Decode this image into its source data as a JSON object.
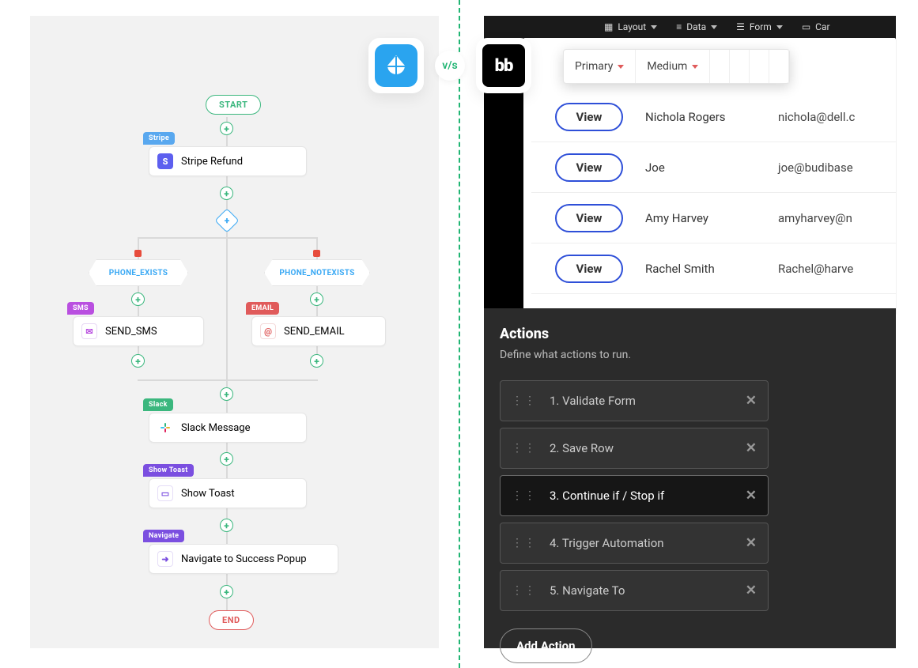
{
  "compare": {
    "vs_label": "v/s",
    "right_logo_text": "bb"
  },
  "flow": {
    "start_label": "START",
    "end_label": "END",
    "nodes": {
      "stripe": {
        "tag": "Stripe",
        "tag_color": "#59a8ef",
        "label": "Stripe Refund"
      },
      "sms": {
        "tag": "SMS",
        "tag_color": "#b94fe0",
        "label": "SEND_SMS"
      },
      "email": {
        "tag": "EMAIL",
        "tag_color": "#e05b5b",
        "label": "SEND_EMAIL"
      },
      "slack": {
        "tag": "Slack",
        "tag_color": "#3bb77e",
        "label": "Slack Message"
      },
      "toast": {
        "tag": "Show Toast",
        "tag_color": "#7b4fe0",
        "label": "Show Toast"
      },
      "navigate": {
        "tag": "Navigate",
        "tag_color": "#7b4fe0",
        "label": "Navigate to Success Popup"
      }
    },
    "branches": {
      "left": "PHONE_EXISTS",
      "right": "PHONE_NOTEXISTS"
    }
  },
  "bb": {
    "top_menu": [
      "Layout",
      "Data",
      "Form",
      "Car"
    ],
    "toolbar": {
      "primary": "Primary",
      "size": "Medium"
    },
    "view_label": "View",
    "rows": [
      {
        "name": "Nichola Rogers",
        "email": "nichola@dell.c"
      },
      {
        "name": "Joe",
        "email": "joe@budibase"
      },
      {
        "name": "Amy Harvey",
        "email": "amyharvey@n"
      },
      {
        "name": "Rachel Smith",
        "email": "Rachel@harve"
      }
    ],
    "actions_panel": {
      "title": "Actions",
      "subtitle": "Define what actions to run.",
      "items": [
        "1. Validate Form",
        "2. Save Row",
        "3. Continue if / Stop if",
        "4. Trigger Automation",
        "5. Navigate To"
      ],
      "add_label": "Add Action"
    }
  }
}
